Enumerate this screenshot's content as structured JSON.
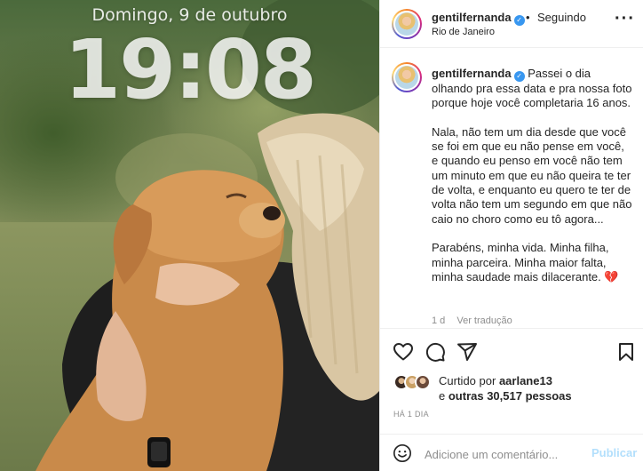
{
  "photo": {
    "lockscreen_date": "Domingo, 9 de outubro",
    "lockscreen_time": "19:08"
  },
  "header": {
    "username": "gentilfernanda",
    "dot": "•",
    "follow_status": "Seguindo",
    "location": "Rio de Janeiro",
    "more_icon": "more-horizontal-icon"
  },
  "caption": {
    "username": "gentilfernanda",
    "paragraphs": [
      "Passei o dia olhando pra essa data e pra nossa foto porque hoje você completaria 16 anos.",
      "Nala, não tem um dia desde que você se foi em que eu não pense em você, e quando eu penso em você não tem um minuto em que eu não queira te ter de volta, e enquanto eu quero te ter de volta não tem um segundo em que não caio no choro como eu tô agora...",
      "Parabéns, minha vida. Minha filha, minha parceira. Minha maior falta, minha saudade mais dilacerante."
    ],
    "emoji": "💔",
    "time": "1 d",
    "translate_label": "Ver tradução"
  },
  "actions": {
    "like_icon": "heart-icon",
    "comment_icon": "comment-icon",
    "share_icon": "paper-plane-icon",
    "save_icon": "bookmark-icon"
  },
  "likes": {
    "prefix": "Curtido por",
    "user": "aarlane13",
    "middle": "e",
    "others": "outras 30,517 pessoas"
  },
  "timeago": "HÁ 1 DIA",
  "comment_box": {
    "placeholder": "Adicione um comentário...",
    "post_label": "Publicar"
  },
  "colors": {
    "verified": "#3897f0",
    "publish_disabled": "#b2dffc",
    "text": "#262626",
    "muted": "#8e8e8e"
  }
}
